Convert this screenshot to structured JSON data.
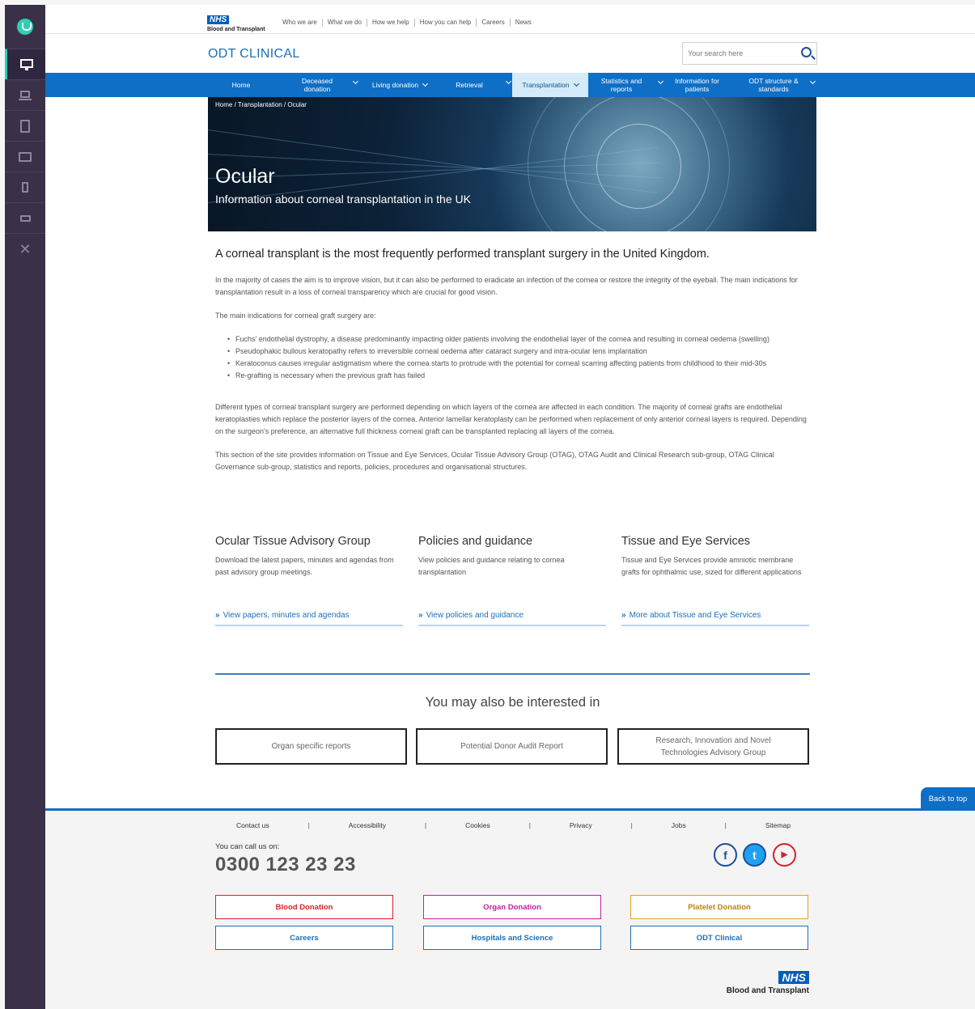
{
  "rail": {
    "items": [
      "desktop",
      "laptop",
      "tablet-portrait",
      "tablet-landscape",
      "phone-portrait",
      "phone-landscape",
      "close"
    ]
  },
  "topbar": {
    "nhs": "NHS",
    "org": "Blood and Transplant",
    "links": [
      "Who we are",
      "What we do",
      "How we help",
      "How you can help",
      "Careers",
      "News"
    ]
  },
  "header": {
    "brand": "ODT CLINICAL",
    "search_placeholder": "Your search here"
  },
  "nav": {
    "items": [
      {
        "label": "Home"
      },
      {
        "label": "Deceased donation"
      },
      {
        "label": "Living donation"
      },
      {
        "label": "Retrieval"
      },
      {
        "label": "Transplantation"
      },
      {
        "label": "Statistics and reports"
      },
      {
        "label": "Information for patients"
      },
      {
        "label": "ODT structure & standards"
      }
    ]
  },
  "hero": {
    "breadcrumb": "Home /  Transplantation / Ocular",
    "title": "Ocular",
    "subtitle": "Information about corneal transplantation in the UK"
  },
  "content": {
    "lead": "A corneal transplant is the most frequently performed transplant surgery in the United Kingdom.",
    "p1": "In the majority of cases the aim is to improve vision, but it can also be performed to eradicate an infection of the cornea or restore the integrity of the eyeball. The main indications for transplantation result in a loss of corneal transparency which are crucial for good vision.",
    "p2": "The main indications for corneal graft surgery are:",
    "bullets": [
      "Fuchs' endothelial dystrophy, a disease predominantly impacting older patients involving the endothelial layer of the cornea and resulting in corneal oedema (swelling)",
      "Pseudophakic bullous keratopathy refers to irreversible corneal oedema after cataract surgery and intra-ocular lens implantation",
      "Keratoconus causes irregular astigmatism where the cornea starts to protrude with the potential for corneal scarring affecting patients from childhood to their mid-30s",
      "Re-grafting is necessary when the previous graft has failed"
    ],
    "p3": "Different types of corneal transplant surgery are performed depending on which layers of the cornea are affected in each condition. The majority of corneal grafts are endothelial keratoplasties which replace the posterior layers of the cornea. Anterior lamellar keratoplasty can be performed when replacement of only anterior corneal layers is required. Depending on the surgeon's preference, an alternative full thickness corneal graft can be transplanted replacing all layers of the cornea.",
    "p4": "This section of the site provides information on Tissue and Eye Services, Ocular Tissue Advisory Group (OTAG), OTAG Audit and Clinical Research sub-group, OTAG Clinical Governance sub-group, statistics and reports, policies, procedures and organisational structures."
  },
  "cards": [
    {
      "title": "Ocular Tissue Advisory Group",
      "desc": "Download the latest papers, minutes and agendas from past advisory group meetings.",
      "link": "View papers, minutes and agendas"
    },
    {
      "title": "Policies and guidance",
      "desc": "View policies and guidance relating to cornea transplantation",
      "link": "View policies and guidance"
    },
    {
      "title": "Tissue and Eye Services",
      "desc": "Tissue and Eye Services provide amniotic membrane grafts for ophthalmic use, sized for different applications",
      "link": "More about Tissue and Eye Services"
    }
  ],
  "also": {
    "heading": "You may also be interested in",
    "items": [
      "Organ specific reports",
      "Potential Donor Audit Report",
      "Research, Innovation and Novel Technologies Advisory Group"
    ]
  },
  "back_to_top": "Back to top",
  "footer": {
    "links": [
      "Contact us",
      "Accessibility",
      "Cookies",
      "Privacy",
      "Jobs",
      "Sitemap"
    ],
    "separator": "|",
    "call_label": "You can call us on:",
    "phone": "0300 123 23 23",
    "social": [
      {
        "icon": "facebook-icon",
        "glyph": "f",
        "color": "#1d4d9b"
      },
      {
        "icon": "twitter-icon",
        "glyph": "t",
        "color": "#1da1f2"
      },
      {
        "icon": "youtube-icon",
        "glyph": "▶",
        "color": "#d8202a"
      }
    ],
    "buttons": [
      {
        "label": "Blood Donation",
        "color": "#d8202a"
      },
      {
        "label": "Organ Donation",
        "color": "#c0219a"
      },
      {
        "label": "Platelet Donation",
        "color": "#e8a21c"
      },
      {
        "label": "Careers",
        "color": "#1d70b8"
      },
      {
        "label": "Hospitals and Science",
        "color": "#1d70b8"
      },
      {
        "label": "ODT Clinical",
        "color": "#1d70b8"
      }
    ],
    "nhs": "NHS",
    "org": "Blood and Transplant"
  }
}
